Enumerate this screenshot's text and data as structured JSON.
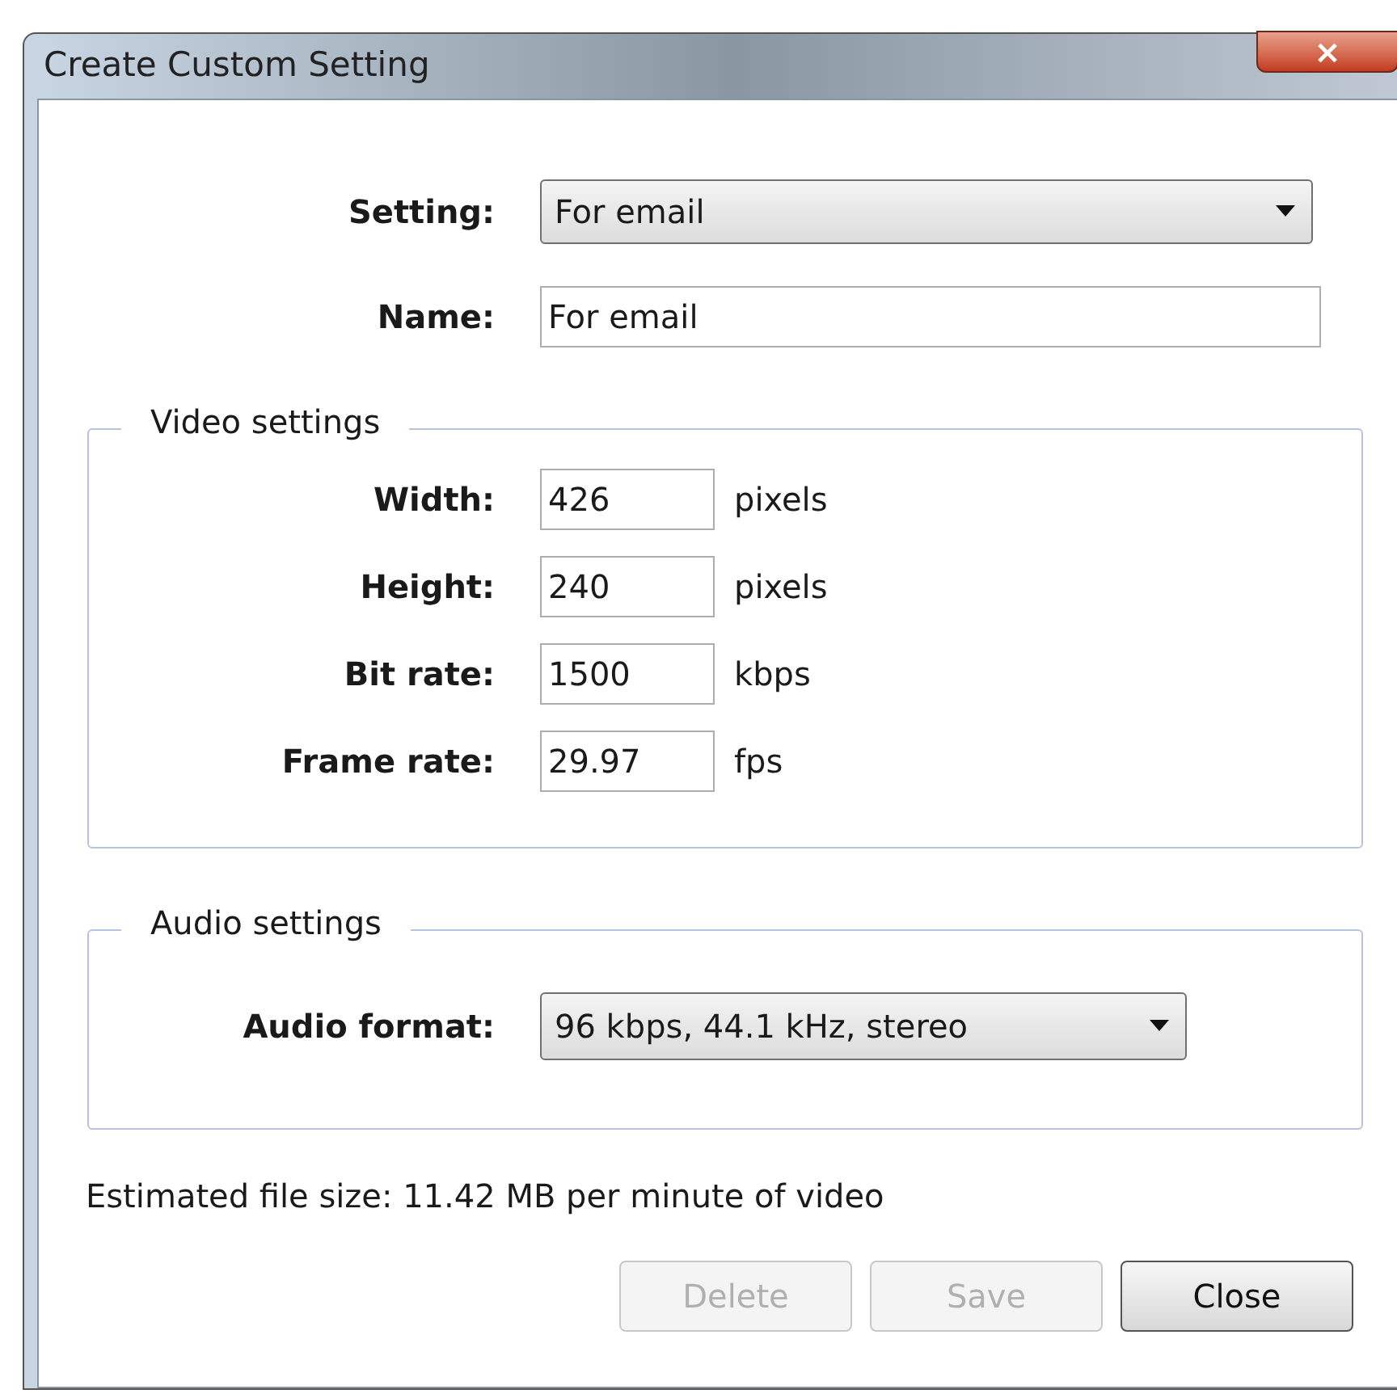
{
  "window": {
    "title": "Create Custom Setting",
    "close_glyph": "×"
  },
  "setting": {
    "label": "Setting:",
    "value": "For email"
  },
  "name": {
    "label": "Name:",
    "value": "For email"
  },
  "video_settings": {
    "title": "Video settings",
    "fields": [
      {
        "label": "Width:",
        "value": "426",
        "unit": "pixels"
      },
      {
        "label": "Height:",
        "value": "240",
        "unit": "pixels"
      },
      {
        "label": "Bit rate:",
        "value": "1500",
        "unit": "kbps"
      },
      {
        "label": "Frame rate:",
        "value": "29.97",
        "unit": "fps"
      }
    ]
  },
  "audio_settings": {
    "title": "Audio settings",
    "label": "Audio format:",
    "value": "96 kbps, 44.1 kHz, stereo"
  },
  "estimate": "Estimated file size: 11.42 MB per minute of video",
  "buttons": [
    {
      "label": "Delete",
      "disabled": true
    },
    {
      "label": "Save",
      "disabled": true
    },
    {
      "label": "Close",
      "disabled": false
    }
  ]
}
